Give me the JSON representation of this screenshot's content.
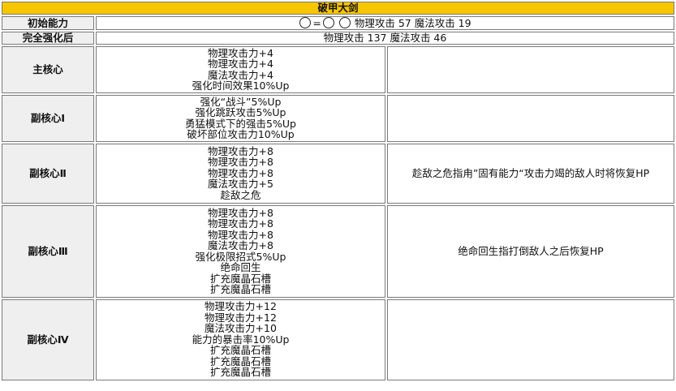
{
  "title": "破甲大剑",
  "initial": {
    "label": "初始能力",
    "eq": "=",
    "text": "物理攻击 57 魔法攻击 19"
  },
  "enhanced": {
    "label": "完全强化后",
    "text": "物理攻击 137 魔法攻击 46"
  },
  "cores": [
    {
      "label": "主核心",
      "lines": [
        "物理攻击力+4",
        "物理攻击力+4",
        "魔法攻击力+4",
        "强化时间效果10%Up"
      ],
      "note": ""
    },
    {
      "label": "副核心Ⅰ",
      "lines": [
        "强化“战斗”5%Up",
        "强化跳跃攻击5%Up",
        "勇猛模式下的强击5%Up",
        "破坏部位攻击力10%Up"
      ],
      "note": ""
    },
    {
      "label": "副核心Ⅱ",
      "lines": [
        "物理攻击力+8",
        "物理攻击力+8",
        "物理攻击力+8",
        "魔法攻击力+5",
        "趁敌之危"
      ],
      "note": "趁敌之危指甪”固有能力“攻击力竭的敌人时将恢复HP"
    },
    {
      "label": "副核心Ⅲ",
      "lines": [
        "物理攻击力+8",
        "物理攻击力+8",
        "物理攻击力+8",
        "魔法攻击力+8",
        "强化极限招式5%Up",
        "绝命回生",
        "扩充魔晶石槽",
        "扩充魔晶石槽"
      ],
      "note": "绝命回生指打倒敌人之后恢复HP"
    },
    {
      "label": "副核心Ⅳ",
      "lines": [
        "物理攻击力+12",
        "物理攻击力+12",
        "魔法攻击力+10",
        "能力的暴击率10%Up",
        "扩充魔晶石槽",
        "扩充魔晶石槽",
        "扩充魔晶石槽"
      ],
      "note": ""
    }
  ]
}
